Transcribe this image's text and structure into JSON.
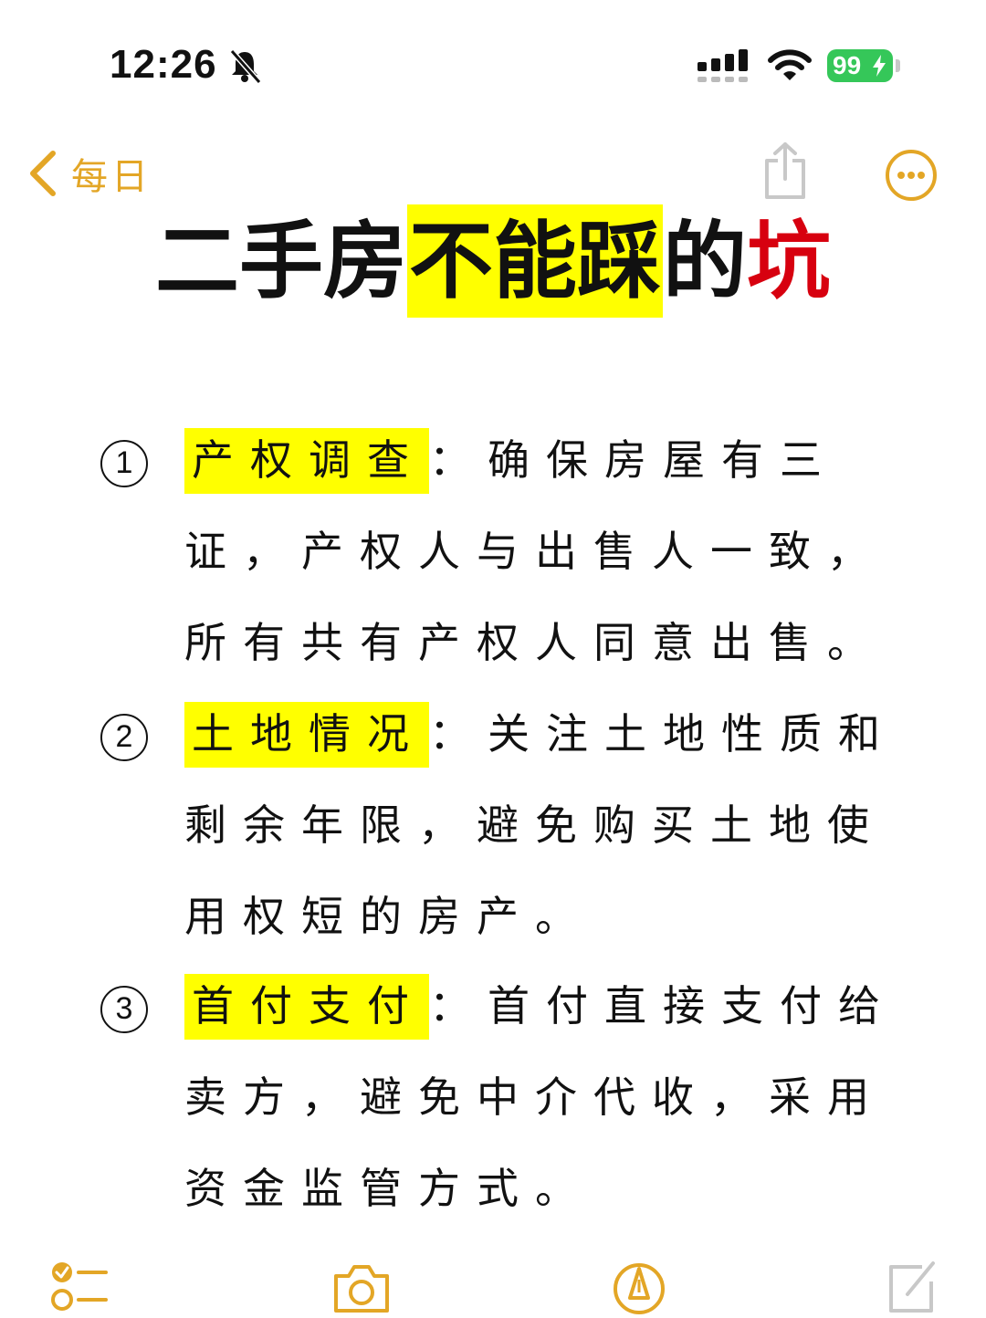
{
  "status_bar": {
    "time": "12:26",
    "battery": "99"
  },
  "nav": {
    "back_label": "每日"
  },
  "title": {
    "part1": "二手房",
    "part2_highlight": "不能踩",
    "part3": "的",
    "part4_red": "坑"
  },
  "items": [
    {
      "number": "1",
      "key": "产权调查",
      "sep": "：",
      "text": "确保房屋有三证，产权人与出售人一致，所有共有产权人同意出售。"
    },
    {
      "number": "2",
      "key": "土地情况",
      "sep": "：",
      "text": "关注土地性质和剩余年限，避免购买土地使用权短的房产。"
    },
    {
      "number": "3",
      "key": "首付支付",
      "sep": "：",
      "text": "首付直接支付给卖方，避免中介代收，采用资金监管方式。"
    }
  ],
  "toolbar": {
    "icons": [
      "checklist-icon",
      "camera-icon",
      "markup-pen-icon",
      "compose-icon"
    ]
  },
  "colors": {
    "accent": "#e3a626",
    "highlight": "#ffff00",
    "title_red": "#d7000f",
    "battery_green": "#35c759"
  }
}
